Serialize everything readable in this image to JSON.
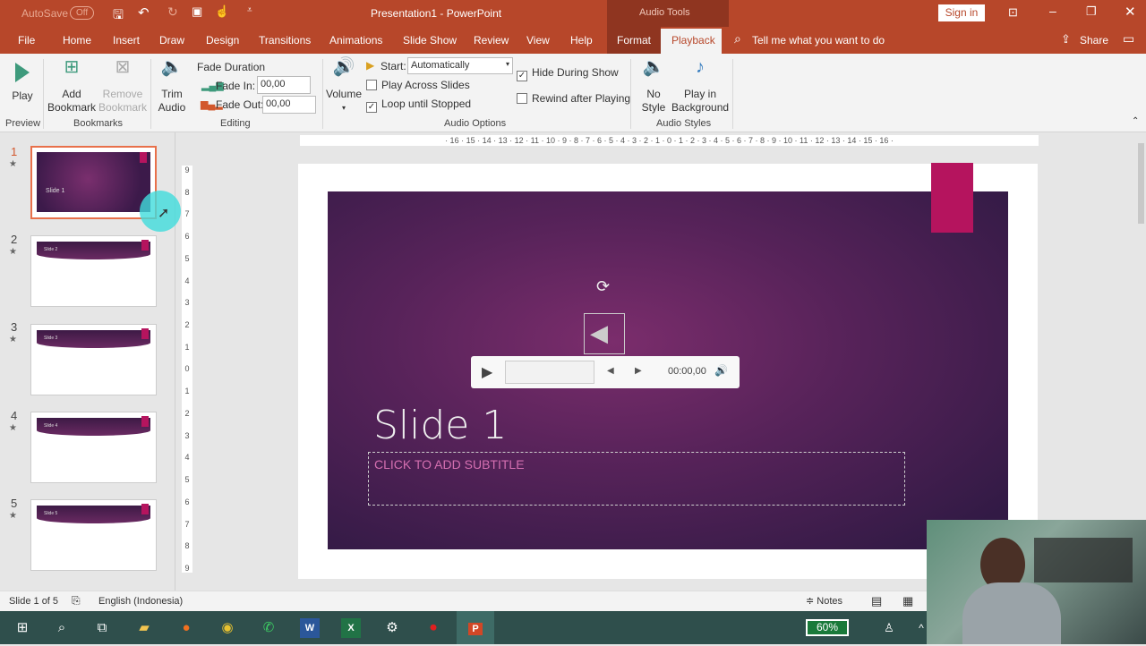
{
  "titlebar": {
    "autosave": "AutoSave",
    "autosave_state": "Off",
    "title": "Presentation1  -  PowerPoint",
    "context": "Audio Tools",
    "sign_in": "Sign in"
  },
  "tabs": [
    "File",
    "Home",
    "Insert",
    "Draw",
    "Design",
    "Transitions",
    "Animations",
    "Slide Show",
    "Review",
    "View",
    "Help",
    "Format",
    "Playback"
  ],
  "active_tab": "Playback",
  "tell_me": "Tell me what you want to do",
  "share": "Share",
  "ribbon": {
    "play": "Play",
    "preview": "Preview",
    "add_bookmark": [
      "Add",
      "Bookmark"
    ],
    "remove_bookmark": [
      "Remove",
      "Bookmark"
    ],
    "bookmarks": "Bookmarks",
    "trim": [
      "Trim",
      "Audio"
    ],
    "fade_duration": "Fade Duration",
    "fade_in": "Fade In:",
    "fade_in_value": "00,00",
    "fade_out": "Fade Out:",
    "fade_out_value": "00,00",
    "editing": "Editing",
    "volume": "Volume",
    "start": "Start:",
    "start_value": "Automatically",
    "play_across": "Play Across Slides",
    "play_across_checked": false,
    "loop": "Loop until Stopped",
    "loop_checked": true,
    "hide": "Hide During Show",
    "hide_checked": true,
    "rewind": "Rewind after Playing",
    "rewind_checked": false,
    "audio_options": "Audio Options",
    "no_style": [
      "No",
      "Style"
    ],
    "play_bg": [
      "Play in",
      "Background"
    ],
    "audio_styles": "Audio Styles"
  },
  "ruler_h": "· 16 · 15 · 14 · 13 · 12 · 11 · 10 · 9 · 8 · 7 · 6 · 5 · 4 · 3 · 2 · 1 · 0 · 1 · 2 · 3 · 4 · 5 · 6 · 7 · 8 · 9 · 10 · 11 · 12 · 13 · 14 · 15 · 16 ·",
  "ruler_v": [
    "9",
    "8",
    "7",
    "6",
    "5",
    "4",
    "3",
    "2",
    "1",
    "0",
    "1",
    "2",
    "3",
    "4",
    "5",
    "6",
    "7",
    "8",
    "9"
  ],
  "slides": [
    {
      "num": "1",
      "label": "Slide 1"
    },
    {
      "num": "2",
      "label": "Slide 2"
    },
    {
      "num": "3",
      "label": "Slide 3"
    },
    {
      "num": "4",
      "label": "Slide 4"
    },
    {
      "num": "5",
      "label": "Slide 5"
    }
  ],
  "slide": {
    "title": "Slide 1",
    "subtitle_placeholder": "CLICK TO ADD SUBTITLE",
    "player_time": "00:00,00"
  },
  "status": {
    "slide": "Slide 1 of 5",
    "language": "English (Indonesia)",
    "notes": "Notes"
  },
  "taskbar": {
    "battery": "60%"
  },
  "colors": {
    "accent": "#b7472a",
    "slide_bg": "#5a2457",
    "tag": "#b5145e",
    "taskbar": "#2f4f4c"
  }
}
